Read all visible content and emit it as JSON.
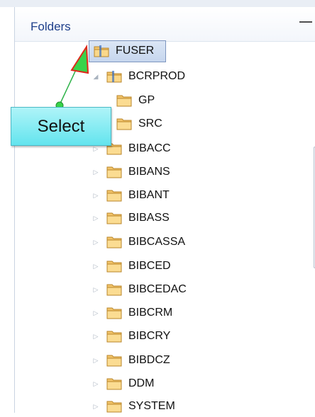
{
  "header": {
    "title": "Folders"
  },
  "tree": {
    "selected": "FUSER",
    "items": [
      {
        "label": "FUSER"
      },
      {
        "label": "BCRPROD"
      },
      {
        "label": "GP"
      },
      {
        "label": "SRC"
      },
      {
        "label": "BIBACC"
      },
      {
        "label": "BIBANS"
      },
      {
        "label": "BIBANT"
      },
      {
        "label": "BIBASS"
      },
      {
        "label": "BIBCASSA"
      },
      {
        "label": "BIBCED"
      },
      {
        "label": "BIBCEDAC"
      },
      {
        "label": "BIBCRM"
      },
      {
        "label": "BIBCRY"
      },
      {
        "label": "BIBDCZ"
      },
      {
        "label": "DDM"
      },
      {
        "label": "SYSTEM"
      }
    ]
  },
  "annotation": {
    "callout_text": "Select"
  },
  "colors": {
    "selection": "#c6d6ee",
    "callout": "#63e4ee",
    "arrow": "#27c93f",
    "arrow_tip": "#e0281b",
    "header_text": "#1e3f8a"
  }
}
